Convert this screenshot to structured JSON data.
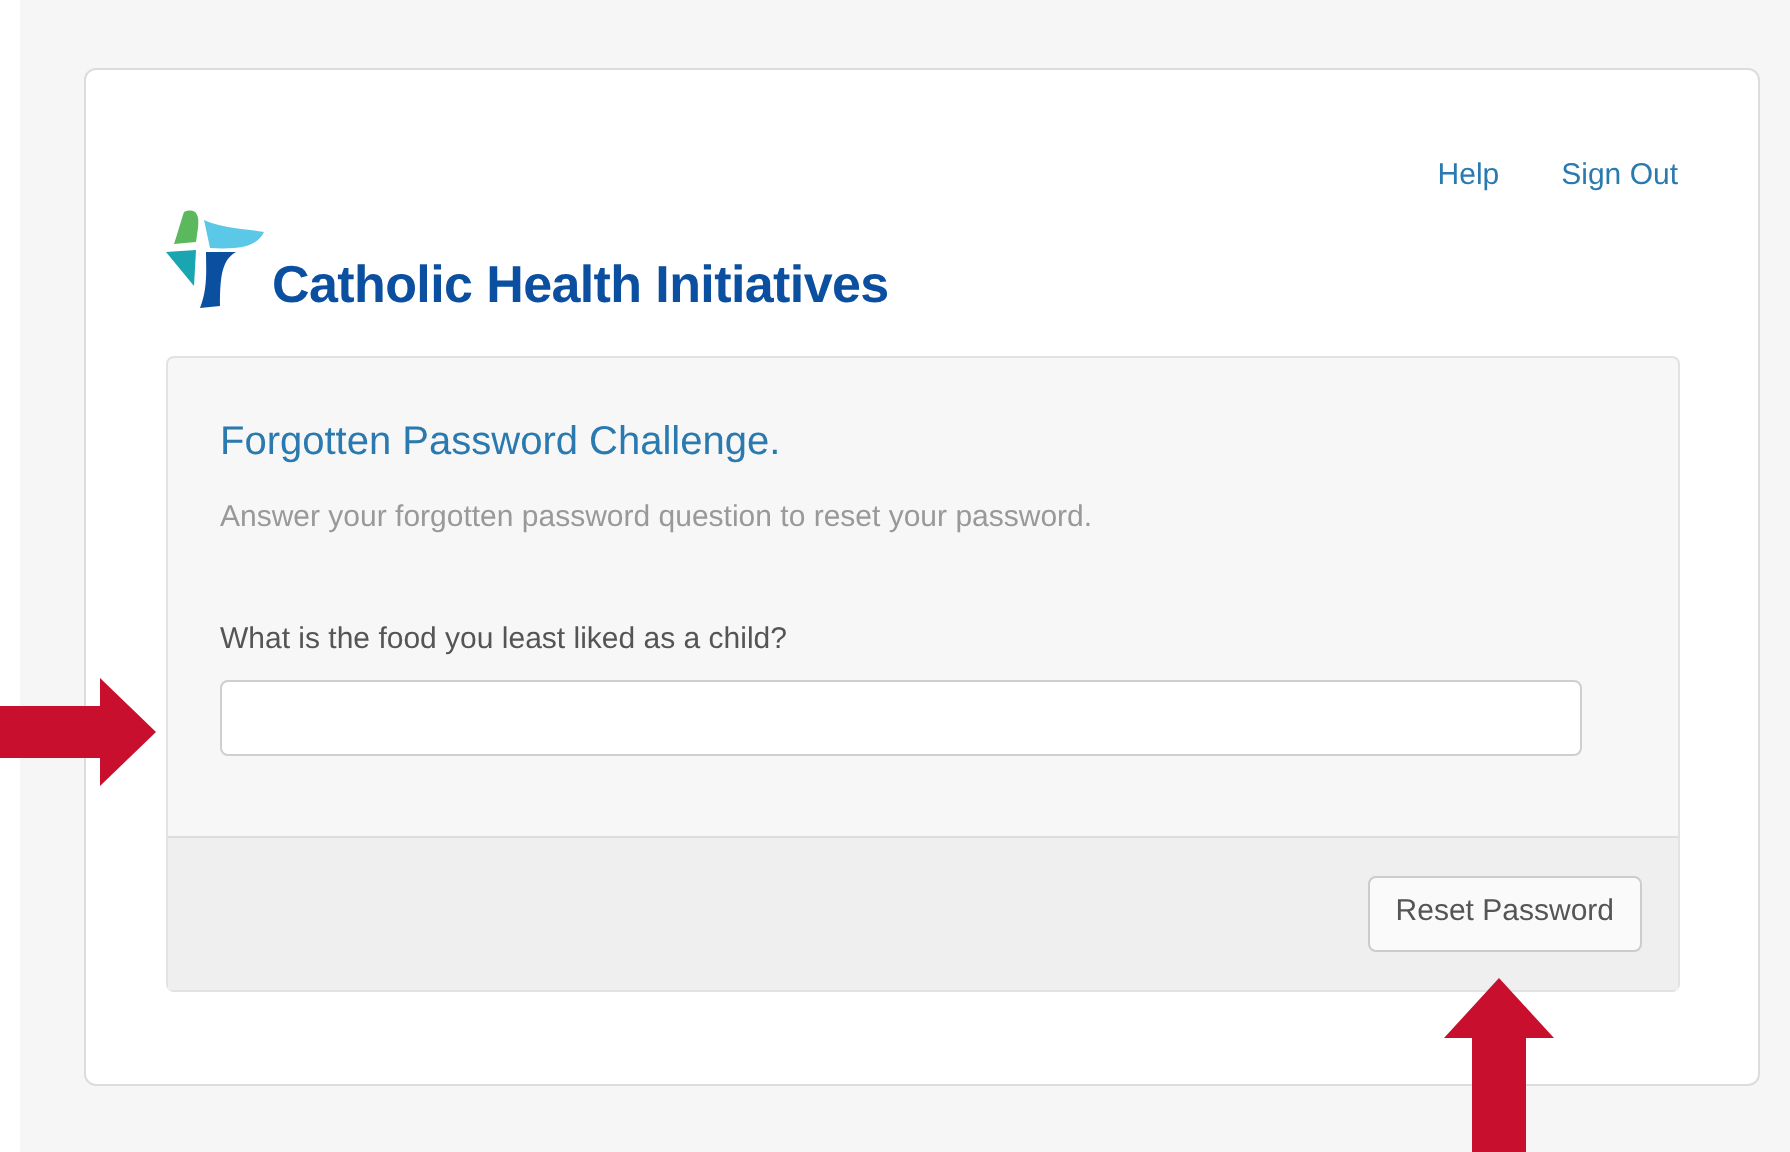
{
  "header_links": [
    "Help",
    "Sign Out"
  ],
  "brand": {
    "name": "Catholic Health Initiatives"
  },
  "panel": {
    "title": "Forgotten Password Challenge.",
    "subtitle": "Answer your forgotten password question to reset your password.",
    "question": {
      "label": "What is the food you least liked as a child?"
    },
    "submit": "Reset Password"
  }
}
